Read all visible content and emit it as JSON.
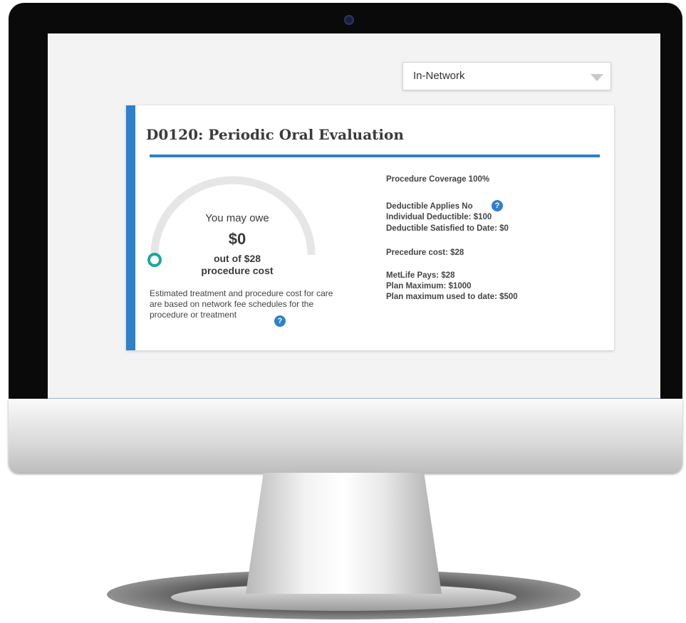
{
  "network_select": {
    "value": "In-Network",
    "icon": "chevron-down-icon"
  },
  "procedure": {
    "title": "D0120: Periodic Oral Evaluation",
    "gauge": {
      "label": "You may owe",
      "amount": "$0",
      "out_of": "out of $28",
      "suffix": "procedure cost",
      "fraction_owed": 0
    },
    "note": "Estimated treatment and procedure cost for care are based on network fee schedules for the procedure or treatment",
    "details": {
      "coverage": "Procedure Coverage 100%",
      "deductible_applies": "Deductible Applies No",
      "individual_deductible": "Individual Deductible: $100",
      "deductible_satisfied": "Deductible Satisfied to Date: $0",
      "procedure_cost": "Precedure cost:  $28",
      "metlife_pays": "MetLife Pays: $28",
      "plan_maximum": "Plan Maximum: $1000",
      "plan_max_used": "Plan maximum used to date:  $500"
    },
    "help_glyph": "?"
  },
  "colors": {
    "accent": "#2f80c9",
    "gauge_marker": "#1aa99b",
    "gauge_track": "#e6e6e6"
  }
}
